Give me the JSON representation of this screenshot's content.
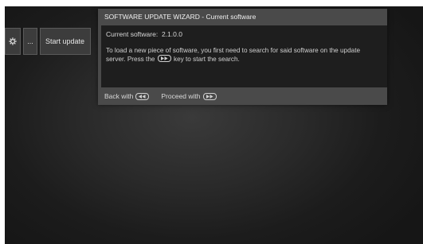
{
  "menu": {
    "gear_icon": "gear-icon",
    "more_label": "...",
    "start_update_label": "Start update"
  },
  "wizard": {
    "title": "SOFTWARE UPDATE WIZARD - Current software",
    "current_software_label": "Current software:",
    "current_software_version": "2.1.0.0",
    "instructions_part1": "To load a new piece of software, you first need to search for said software on the update server. Press the",
    "instructions_part2": "key to start the search.",
    "instructions_key_icon": "fast-forward-key-icon",
    "back_label": "Back with",
    "back_key_icon": "rewind-key-icon",
    "proceed_label": "Proceed with",
    "proceed_key_icon": "fast-forward-key-icon"
  },
  "colors": {
    "panel": "#4a4a4a",
    "panel_body": "#1e1e1e",
    "text": "#e6e6e6"
  }
}
